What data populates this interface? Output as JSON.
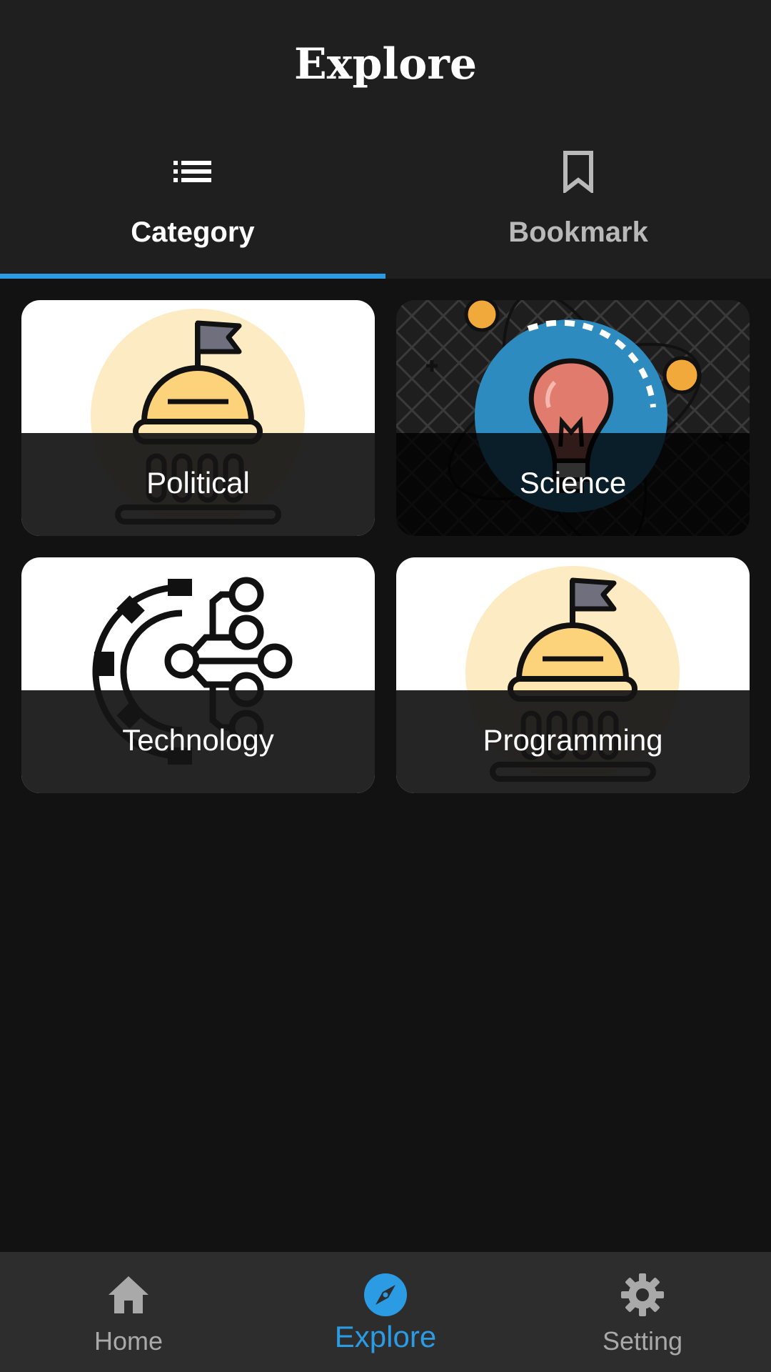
{
  "header": {
    "title": "Explore"
  },
  "tabs": [
    {
      "label": "Category",
      "icon": "list-icon",
      "selected": true
    },
    {
      "label": "Bookmark",
      "icon": "bookmark-icon",
      "selected": false
    }
  ],
  "categories": [
    {
      "label": "Political",
      "image": "capitol-dome-icon"
    },
    {
      "label": "Science",
      "image": "lightbulb-atom-icon"
    },
    {
      "label": "Technology",
      "image": "gear-circuit-icon"
    },
    {
      "label": "Programming",
      "image": "capitol-dome-icon"
    }
  ],
  "bottom_nav": [
    {
      "label": "Home",
      "icon": "home-icon",
      "selected": false
    },
    {
      "label": "Explore",
      "icon": "compass-icon",
      "selected": true
    },
    {
      "label": "Setting",
      "icon": "gear-icon",
      "selected": false
    }
  ],
  "colors": {
    "accent": "#2b9be3",
    "header_bg": "#1f1f1f",
    "page_bg": "#121212",
    "nav_bg": "#2d2d2d",
    "inactive_text": "#a9a9a9"
  }
}
